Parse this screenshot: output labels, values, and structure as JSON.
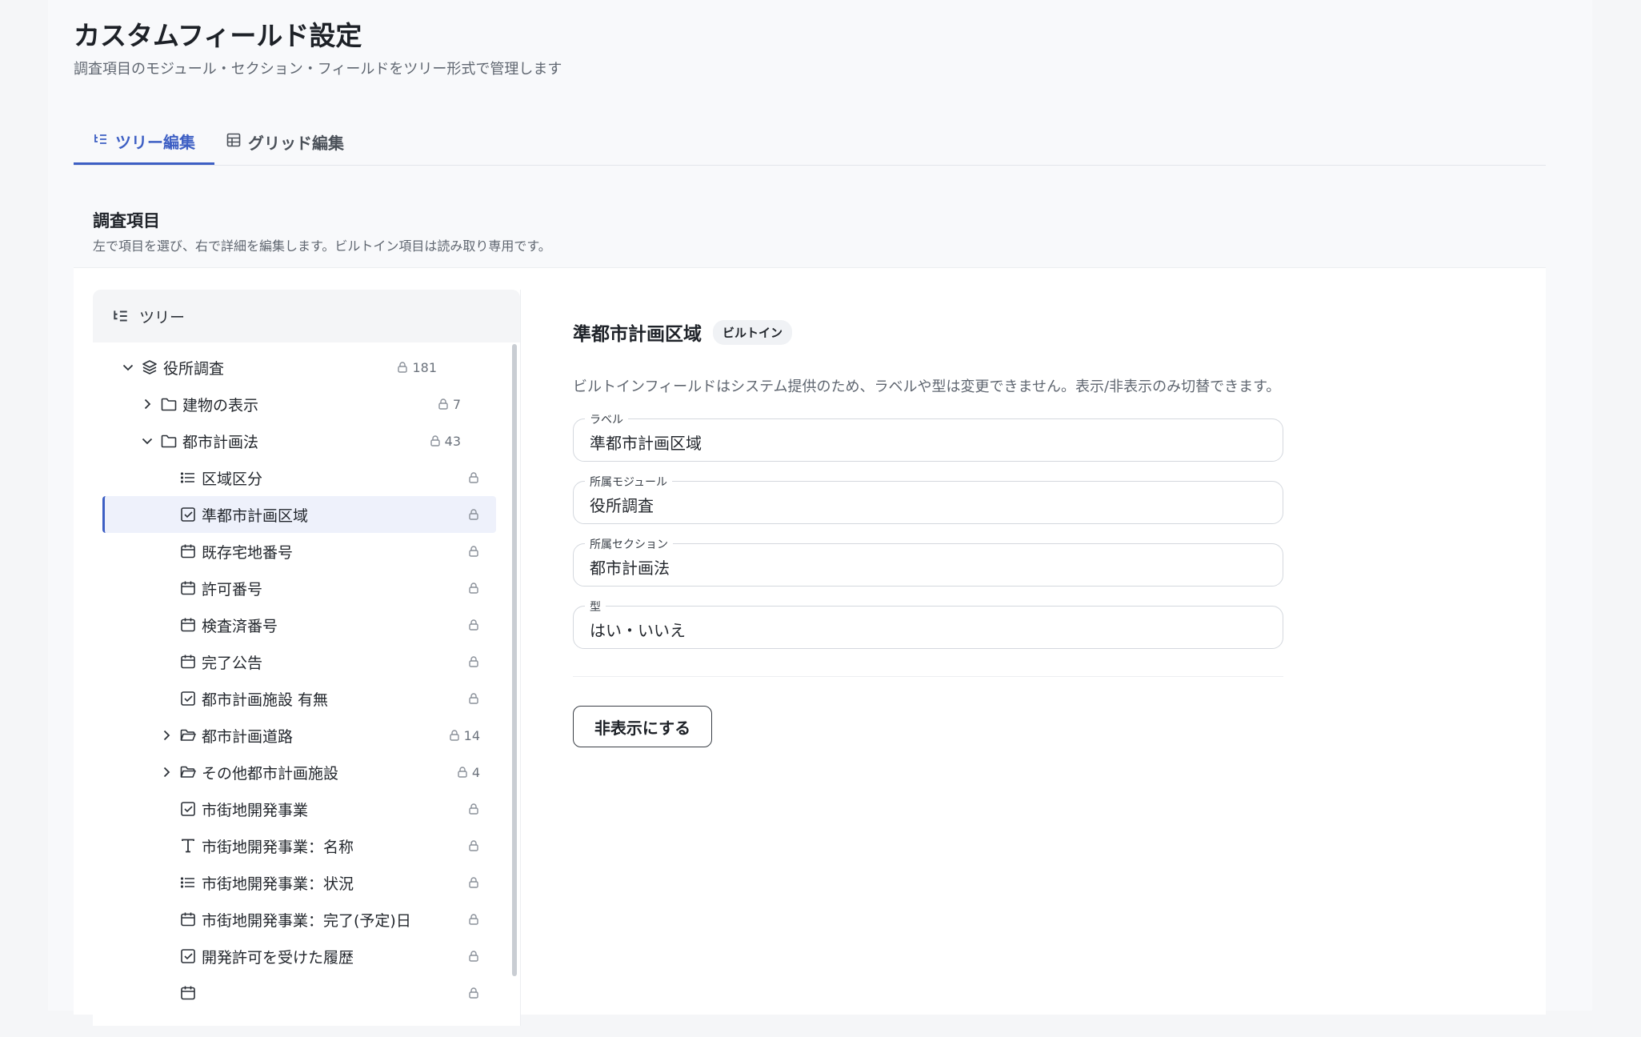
{
  "header": {
    "title": "カスタムフィールド設定",
    "subtitle": "調査項目のモジュール・セクション・フィールドをツリー形式で管理します"
  },
  "tabs": [
    {
      "label": "ツリー編集",
      "icon": "tree-list-icon",
      "active": true
    },
    {
      "label": "グリッド編集",
      "icon": "grid-icon",
      "active": false
    }
  ],
  "section": {
    "title": "調査項目",
    "description": "左で項目を選び、右で詳細を編集します。ビルトイン項目は読み取り専用です。"
  },
  "tree": {
    "header": "ツリー",
    "items": [
      {
        "label": "役所調査",
        "icon": "layers-icon",
        "expanded": true,
        "count": "181",
        "depth": 0
      },
      {
        "label": "建物の表示",
        "icon": "folder-icon",
        "expanded": false,
        "count": "7",
        "depth": 1
      },
      {
        "label": "都市計画法",
        "icon": "folder-icon",
        "expanded": true,
        "count": "43",
        "depth": 1
      },
      {
        "label": "区域区分",
        "icon": "list-icon",
        "depth": 2
      },
      {
        "label": "準都市計画区域",
        "icon": "checkbox-icon",
        "depth": 2,
        "selected": true
      },
      {
        "label": "既存宅地番号",
        "icon": "calendar-icon",
        "depth": 2
      },
      {
        "label": "許可番号",
        "icon": "calendar-icon",
        "depth": 2
      },
      {
        "label": "検査済番号",
        "icon": "calendar-icon",
        "depth": 2
      },
      {
        "label": "完了公告",
        "icon": "calendar-icon",
        "depth": 2
      },
      {
        "label": "都市計画施設 有無",
        "icon": "checkbox-icon",
        "depth": 2
      },
      {
        "label": "都市計画道路",
        "icon": "folder-open-icon",
        "expanded": false,
        "count": "14",
        "depth": 2
      },
      {
        "label": "その他都市計画施設",
        "icon": "folder-open-icon",
        "expanded": false,
        "count": "4",
        "depth": 2
      },
      {
        "label": "市街地開発事業",
        "icon": "checkbox-icon",
        "depth": 2
      },
      {
        "label": "市街地開発事業：名称",
        "icon": "text-icon",
        "depth": 2
      },
      {
        "label": "市街地開発事業：状況",
        "icon": "list-icon",
        "depth": 2
      },
      {
        "label": "市街地開発事業：完了(予定)日",
        "icon": "calendar-icon",
        "depth": 2
      },
      {
        "label": "開発許可を受けた履歴",
        "icon": "checkbox-icon",
        "depth": 2
      },
      {
        "label": "",
        "icon": "calendar-icon",
        "depth": 2
      }
    ]
  },
  "detail": {
    "title": "準都市計画区域",
    "badge": "ビルトイン",
    "note": "ビルトインフィールドはシステム提供のため、ラベルや型は変更できません。表示/非表示のみ切替できます。",
    "fields": [
      {
        "label": "ラベル",
        "value": "準都市計画区域"
      },
      {
        "label": "所属モジュール",
        "value": "役所調査"
      },
      {
        "label": "所属セクション",
        "value": "都市計画法"
      },
      {
        "label": "型",
        "value": "はい・いいえ"
      }
    ],
    "hide_button": "非表示にする"
  },
  "colors": {
    "accent": "#3d5fc4",
    "selected_bg": "#eef1fb"
  }
}
